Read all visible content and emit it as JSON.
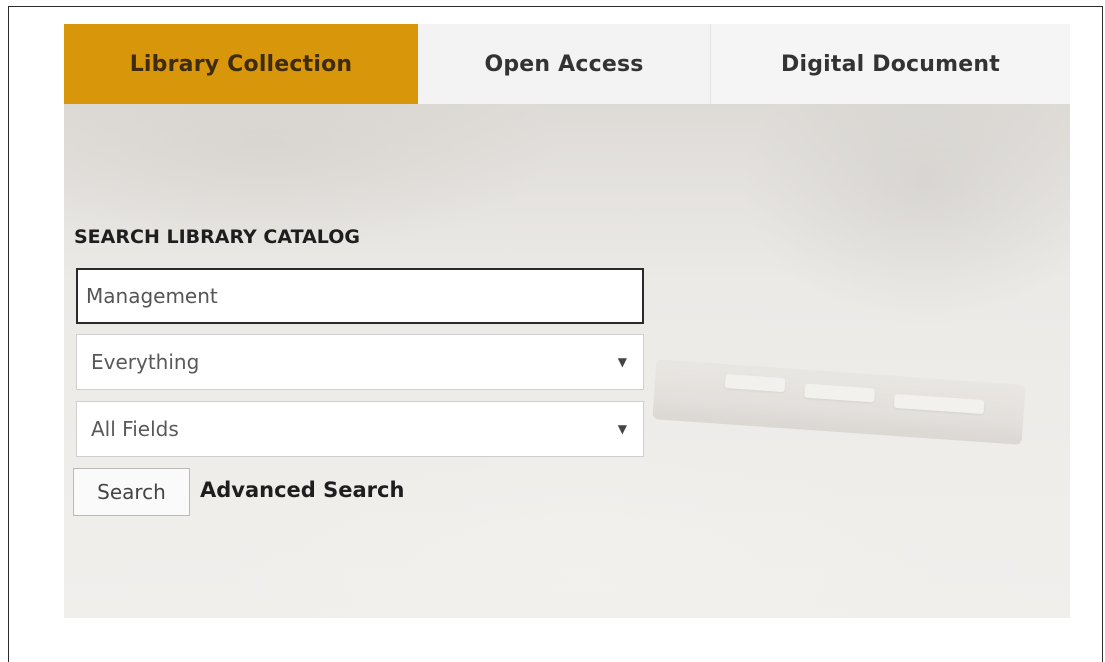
{
  "tabs": [
    {
      "label": "Library Collection",
      "active": true
    },
    {
      "label": "Open Access",
      "active": false
    },
    {
      "label": "Digital Document",
      "active": false
    }
  ],
  "search": {
    "title": "SEARCH LIBRARY CATALOG",
    "query_value": "Management",
    "scope_selected": "Everything",
    "field_selected": "All Fields",
    "button_label": "Search",
    "advanced_link": "Advanced Search"
  },
  "colors": {
    "active_tab": "#d8960b",
    "inactive_tab": "#f3f3f3"
  },
  "icons": {
    "dropdown": "caret-down-icon"
  }
}
